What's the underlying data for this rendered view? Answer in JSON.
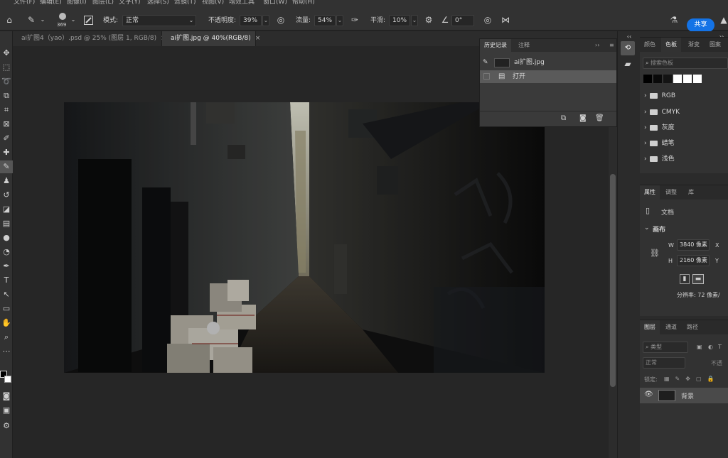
{
  "menu": [
    "文件(F)",
    "编辑(E)",
    "图像(I)",
    "图层(L)",
    "文字(Y)",
    "选择(S)",
    "滤镜(T)",
    "视图(V)",
    "增效工具",
    "窗口(W)",
    "帮助(H)"
  ],
  "options": {
    "brush_size": "369",
    "mode_label": "模式:",
    "mode_value": "正常",
    "opacity_label": "不透明度:",
    "opacity_value": "39%",
    "flow_label": "流量:",
    "flow_value": "54%",
    "smoothing_label": "平滑:",
    "smoothing_value": "10%",
    "angle_value": "0°",
    "share_label": "共享"
  },
  "tabs": [
    {
      "label": "ai扩图4（yao）.psd @ 25% (图层 1, RGB/8)",
      "close": "×"
    },
    {
      "label": "ai扩图.jpg @ 40%(RGB/8)",
      "close": "×"
    }
  ],
  "history_panel": {
    "tab_history": "历史记录",
    "tab_notes": "注释",
    "snapshot_label": "ai扩图.jpg",
    "step_label": "打开"
  },
  "swatches_panel": {
    "tabs": [
      "颜色",
      "色板",
      "渐变",
      "图案"
    ],
    "search_placeholder": "搜索色板",
    "groups": [
      "RGB",
      "CMYK",
      "灰度",
      "蜡笔",
      "浅色"
    ],
    "colors": [
      "#000000",
      "#0a0a0a",
      "#141414",
      "#ffffff",
      "#ffffff",
      "#ffffff"
    ]
  },
  "properties_panel": {
    "tabs": [
      "属性",
      "调整",
      "库"
    ],
    "doc_label": "文档",
    "section": "画布",
    "w_label": "W",
    "w_value": "3840 像素",
    "h_label": "H",
    "h_value": "2160 像素",
    "x_label": "X",
    "y_label": "Y",
    "resolution": "分辨率: 72 像素/"
  },
  "layers_panel": {
    "tabs": [
      "图层",
      "通道",
      "路径"
    ],
    "filter_label": "类型",
    "blend_mode": "正常",
    "opacity_label": "不透",
    "lock_label": "锁定:",
    "layer_name": "背景"
  }
}
